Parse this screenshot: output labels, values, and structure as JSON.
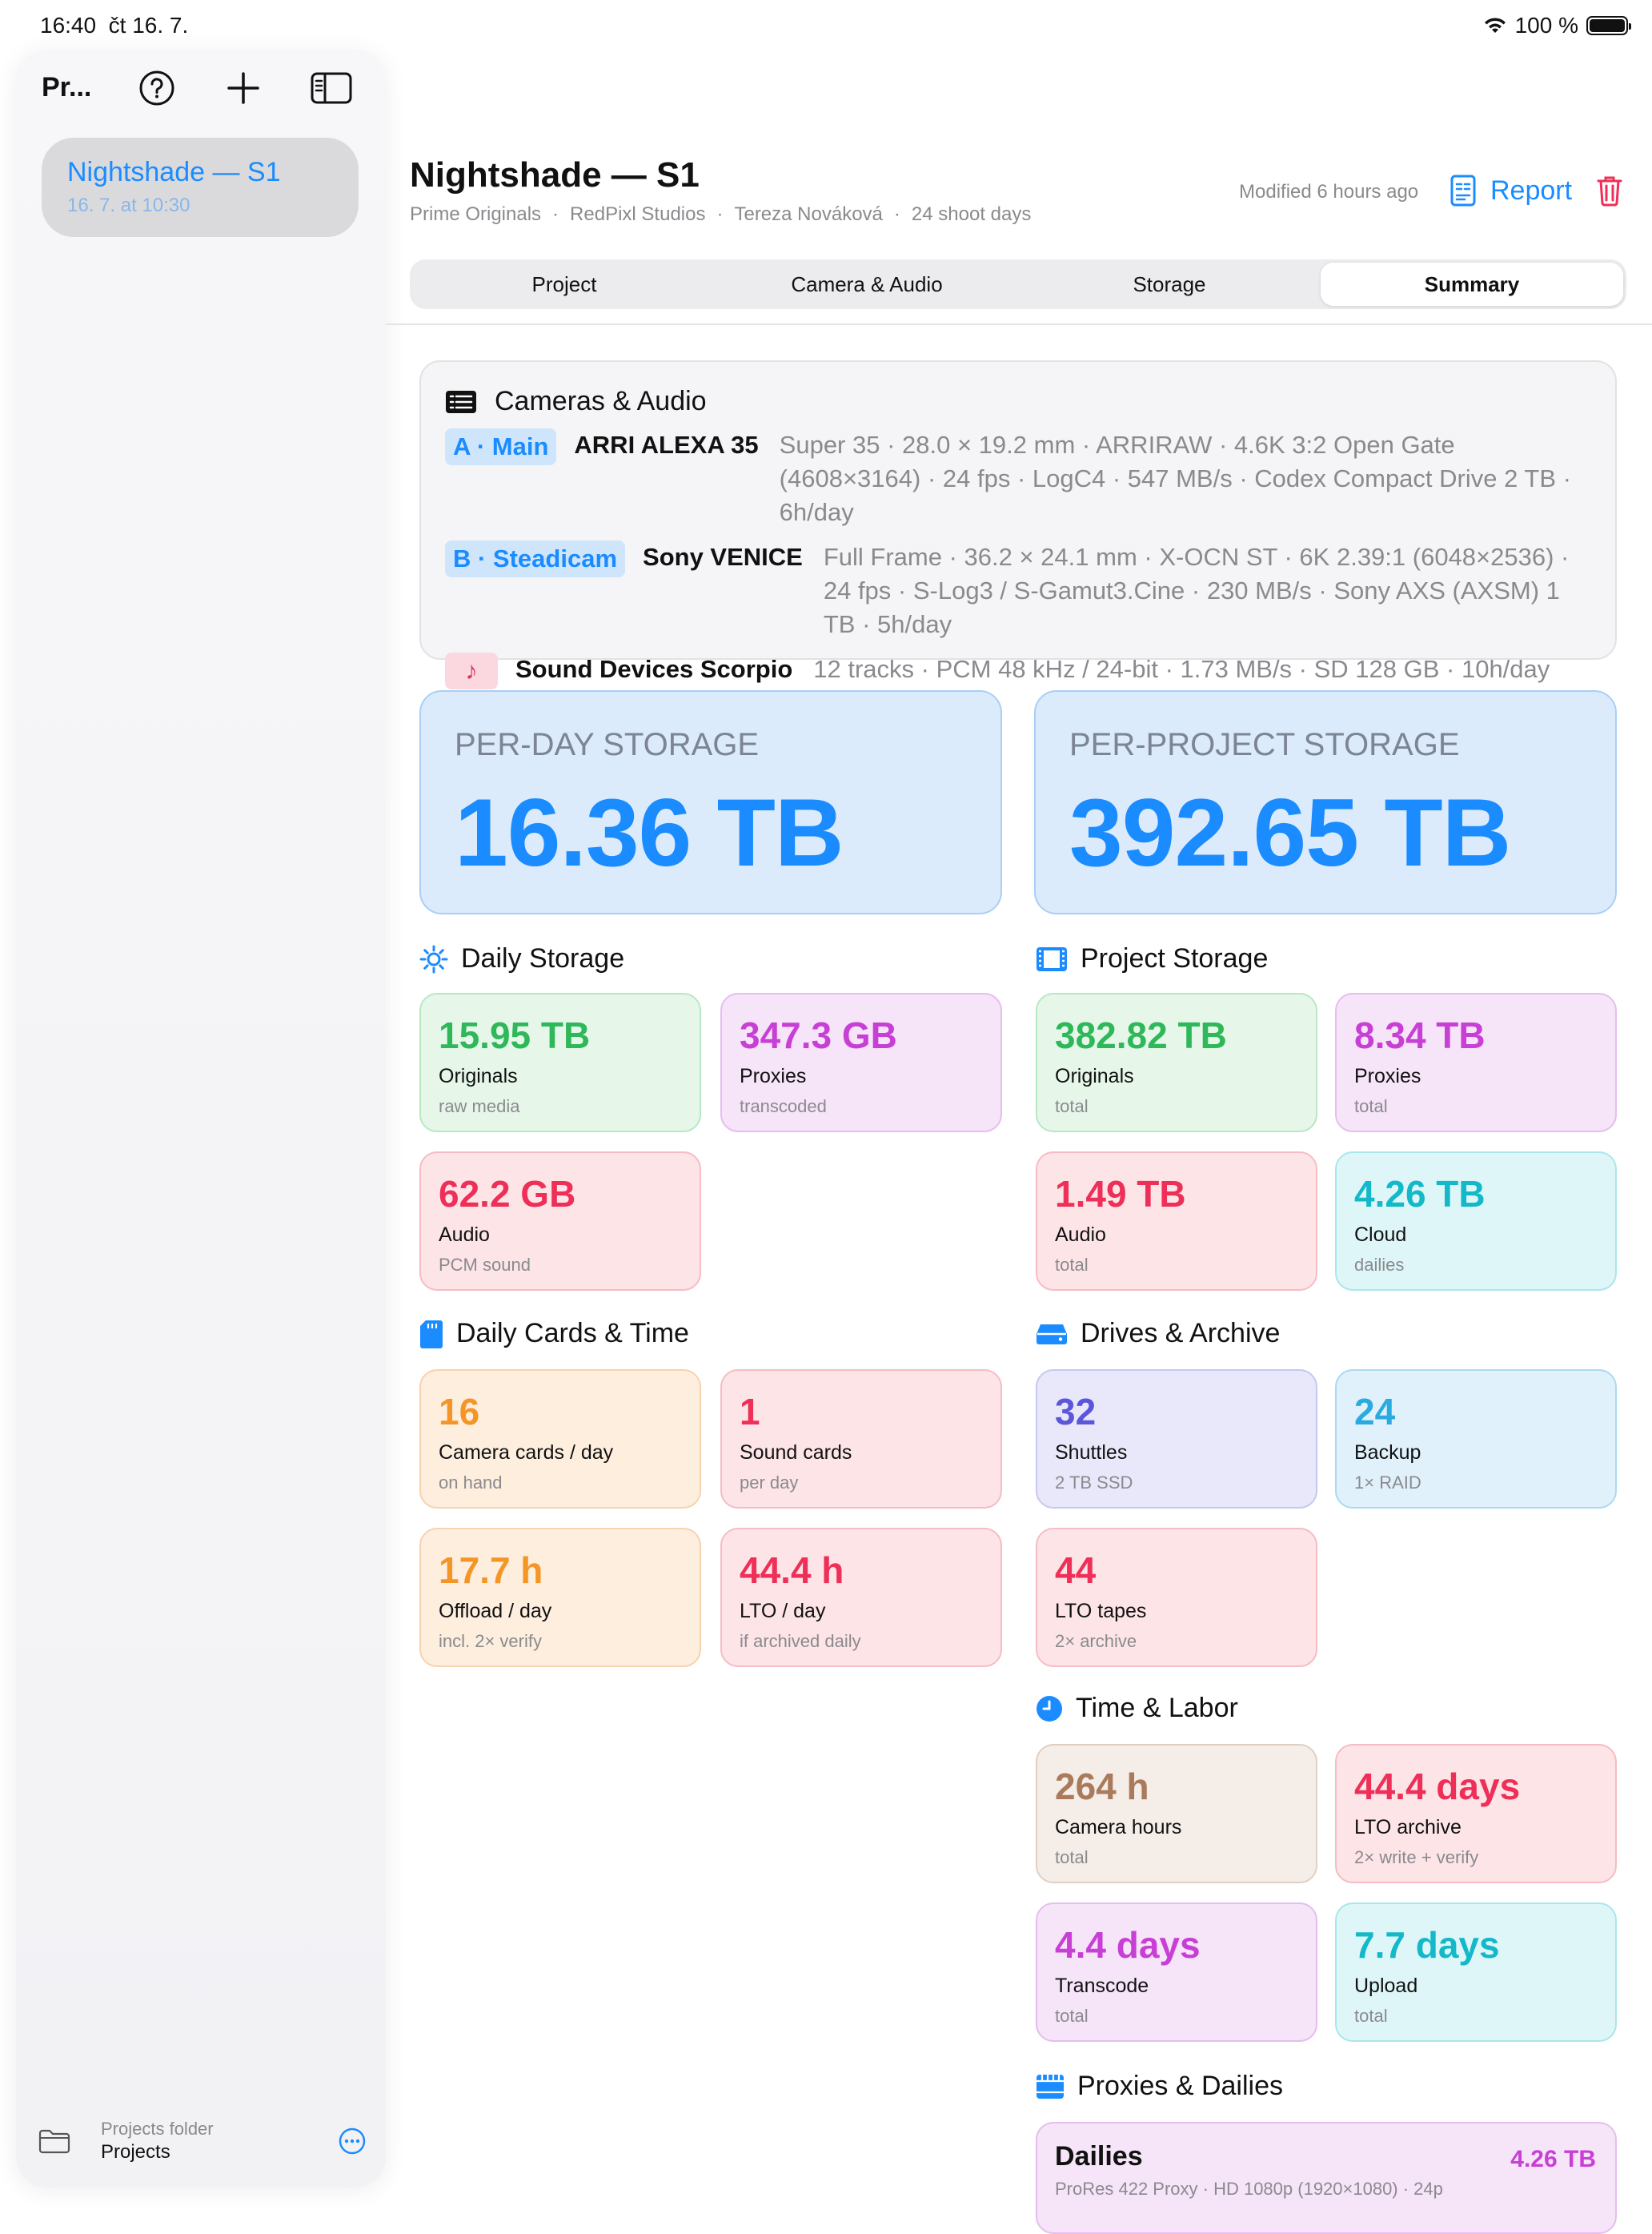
{
  "status": {
    "time": "16:40",
    "date": "čt 16. 7.",
    "battery": "100 %"
  },
  "sidebar": {
    "title": "Pr...",
    "item_name": "Nightshade — S1",
    "item_date": "16. 7. at 10:30",
    "folder_label": "Projects folder",
    "folder_value": "Projects"
  },
  "header": {
    "title": "Nightshade — S1",
    "sub": [
      "Prime Originals",
      "RedPixl Studios",
      "Tereza Nováková",
      "24 shoot days"
    ],
    "sep": "·",
    "modified": "Modified 6 hours ago",
    "report": "Report"
  },
  "tabs": [
    "Project",
    "Camera & Audio",
    "Storage",
    "Summary"
  ],
  "cameras": {
    "title": "Cameras & Audio",
    "a_pill": "A · Main",
    "a_name": "ARRI ALEXA 35",
    "a_spec": "Super 35 · 28.0 × 19.2 mm · ARRIRAW · 4.6K 3:2 Open Gate (4608×3164) · 24 fps · LogC4 · 547 MB/s · Codex Compact Drive 2 TB · 6h/day",
    "b_pill": "B · Steadicam",
    "b_name": "Sony VENICE",
    "b_spec": "Full Frame · 36.2 × 24.1 mm · X-OCN ST · 6K 2.39:1 (6048×2536) · 24 fps · S-Log3 / S-Gamut3.Cine · 230 MB/s · Sony AXS (AXSM) 1 TB · 5h/day",
    "s_icon": "♪",
    "s_name": "Sound Devices Scorpio",
    "s_spec": "12 tracks · PCM 48 kHz / 24-bit · 1.73 MB/s · SD 128 GB · 10h/day"
  },
  "per_day": {
    "label": "PER-DAY STORAGE",
    "value": "16.36 TB"
  },
  "per_project": {
    "label": "PER-PROJECT STORAGE",
    "value": "392.65 TB"
  },
  "sections": {
    "daily_storage": "Daily Storage",
    "project_storage": "Project Storage",
    "daily_cards": "Daily Cards & Time",
    "drives": "Drives & Archive",
    "time_labor": "Time & Labor",
    "proxies": "Proxies & Dailies"
  },
  "daily_storage": [
    {
      "v": "15.95 TB",
      "l": "Originals",
      "s": "raw media"
    },
    {
      "v": "347.3 GB",
      "l": "Proxies",
      "s": "transcoded"
    },
    {
      "v": "62.2 GB",
      "l": "Audio",
      "s": "PCM sound"
    }
  ],
  "project_storage": [
    {
      "v": "382.82 TB",
      "l": "Originals",
      "s": "total"
    },
    {
      "v": "8.34 TB",
      "l": "Proxies",
      "s": "total"
    },
    {
      "v": "1.49 TB",
      "l": "Audio",
      "s": "total"
    },
    {
      "v": "4.26 TB",
      "l": "Cloud",
      "s": "dailies"
    }
  ],
  "daily_cards": [
    {
      "v": "16",
      "l": "Camera cards / day",
      "s": "on hand"
    },
    {
      "v": "1",
      "l": "Sound cards",
      "s": "per day"
    },
    {
      "v": "17.7 h",
      "l": "Offload / day",
      "s": "incl. 2× verify"
    },
    {
      "v": "44.4 h",
      "l": "LTO / day",
      "s": "if archived daily"
    }
  ],
  "drives": [
    {
      "v": "32",
      "l": "Shuttles",
      "s": "2 TB SSD"
    },
    {
      "v": "24",
      "l": "Backup",
      "s": "1× RAID"
    },
    {
      "v": "44",
      "l": "LTO tapes",
      "s": "2× archive"
    }
  ],
  "time_labor": [
    {
      "v": "264 h",
      "l": "Camera hours",
      "s": "total"
    },
    {
      "v": "44.4 days",
      "l": "LTO archive",
      "s": "2× write + verify"
    },
    {
      "v": "4.4 days",
      "l": "Transcode",
      "s": "total"
    },
    {
      "v": "7.7 days",
      "l": "Upload",
      "s": "total"
    }
  ],
  "dailies": {
    "title": "Dailies",
    "value": "4.26 TB",
    "spec": "ProRes 422 Proxy · HD 1080p (1920×1080) · 24p"
  },
  "colors": {
    "accent": "#1a8cff",
    "green": "#2fb85a",
    "purple": "#c83fd6",
    "red": "#ee2f57",
    "teal": "#13b9c9",
    "orange": "#f59526",
    "indigo": "#5b56da",
    "brown": "#a97a5b"
  }
}
